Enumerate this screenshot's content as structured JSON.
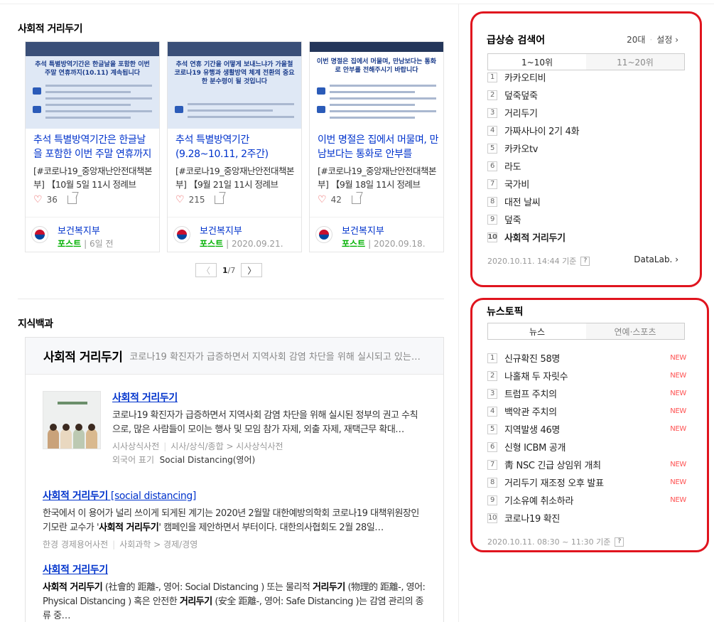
{
  "posts": {
    "section_title": "사회적 거리두기",
    "cards": [
      {
        "thumb_head": "추석 특별방역기간은 한글날을 포함한 이번 주말 연휴까지(10.11) 계속됩니다",
        "title": "추석 특별방역기간은 한글날을 포함한 이번 주말 연휴까지",
        "desc": "[#코로나19_중앙재난안전대책본부] 【10월 5일 11시 정례브",
        "likes": "36",
        "author": "보건복지부",
        "tag": "포스트",
        "time": "| 6일 전"
      },
      {
        "thumb_head": "추석 연휴 기간을 어떻게 보내느냐가 가을철 코로나19 유행과 생활방역 체계 전환의 중요한 분수령이 될 것입니다",
        "title": "추석 특별방역기간 (9.28~10.11, 2주간)",
        "desc": "[#코로나19_중앙재난안전대책본부] 【9월 21일 11시 정례브",
        "likes": "215",
        "author": "보건복지부",
        "tag": "포스트",
        "time": "| 2020.09.21."
      },
      {
        "thumb_head": "이번 명절은 집에서 머물며, 만남보다는 통화로 안부를 전해주시기 바랍니다",
        "title": "이번 명절은 집에서 머물며, 만남보다는 통화로 안부를",
        "desc": "[#코로나19_중앙재난안전대책본부] 【9월 18일 11시 정례브",
        "likes": "42",
        "author": "보건복지부",
        "tag": "포스트",
        "time": "| 2020.09.18."
      }
    ],
    "pager": {
      "current": "1",
      "total": "/7",
      "prev": "〈",
      "next": "〉"
    }
  },
  "knowledge": {
    "section_title": "지식백과",
    "head_title": "사회적 거리두기",
    "head_summary": "코로나19 확진자가 급증하면서 지역사회 감염 차단을 위해 실시되고 있는…",
    "entry1": {
      "title": "사회적 거리두기",
      "text": "코로나19 확진자가 급증하면서 지역사회 감염 차단을 위해 실시된 정부의 권고 수칙으로, 많은 사람들이 모이는 행사 및 모임 참가 자제, 외출 자제, 재택근무 확대…",
      "source": "시사상식사전",
      "path": "시사/상식/종합 > 시사상식사전",
      "foreign_label": "외국어 표기",
      "foreign_value": "Social Distancing(영어)"
    },
    "entry2": {
      "title": "사회적 거리두기",
      "title_sub": " [social distancing]",
      "text_a": "한국에서 이 용어가 널리 쓰이게 되게된 계기는 2020년 2월말 대한예방의학회 코로나19 대책위원장인 기모란 교수가 '",
      "text_bold": "사회적 거리두기",
      "text_b": "' 캠페인을 제안하면서 부터이다. 대한의사협회도 2월 28일…",
      "source": "한경 경제용어사전",
      "path": "사회과학 > 경제/경영"
    },
    "entry3": {
      "title": "사회적 거리두기",
      "b1": "사회적 거리두기",
      "t1": " (社會的 距離-, 영어: Social Distancing ) 또는 물리적 ",
      "b2": "거리두기",
      "t2": " (物理的 距離-, 영어: Physical Distancing ) 혹은 안전한 ",
      "b3": "거리두기",
      "t3": " (安全 距離-, 영어: Safe Distancing )는 감염 관리의 종류 중…"
    }
  },
  "trending": {
    "title": "급상승 검색어",
    "age": "20대",
    "settings": "설정 ›",
    "tabs": [
      "1~10위",
      "11~20위"
    ],
    "items": [
      "카카오티비",
      "덮죽덮죽",
      "거리두기",
      "가짜사나이 2기 4화",
      "카카오tv",
      "라도",
      "국가비",
      "대전 날씨",
      "덮죽",
      "사회적 거리두기"
    ],
    "footer": "2020.10.11. 14:44 기준",
    "help": "?",
    "datalab": "DataLab. ›"
  },
  "news": {
    "title": "뉴스토픽",
    "tabs": [
      "뉴스",
      "연예·스포츠"
    ],
    "new_label": "NEW",
    "items": [
      {
        "text": "신규확진 58명",
        "new": true
      },
      {
        "text": "나홀채 두 자릿수",
        "new": true
      },
      {
        "text": "트럼프 주치의",
        "new": true
      },
      {
        "text": "백악관 주치의",
        "new": true
      },
      {
        "text": "지역발생 46명",
        "new": true
      },
      {
        "text": "신형 ICBM 공개",
        "new": false
      },
      {
        "text": "靑 NSC 긴급 상임위 개최",
        "new": true
      },
      {
        "text": "거리두기 재조정 오후 발표",
        "new": true
      },
      {
        "text": "기소유예 취소하라",
        "new": true
      },
      {
        "text": "코로나19 확진",
        "new": false
      }
    ],
    "footer": "2020.10.11. 08:30 ~ 11:30 기준",
    "help": "?"
  },
  "colors": {
    "link": "#0033cc",
    "highlight": "#e0141e",
    "post_tag": "#00b100",
    "new": "#ff5252"
  }
}
